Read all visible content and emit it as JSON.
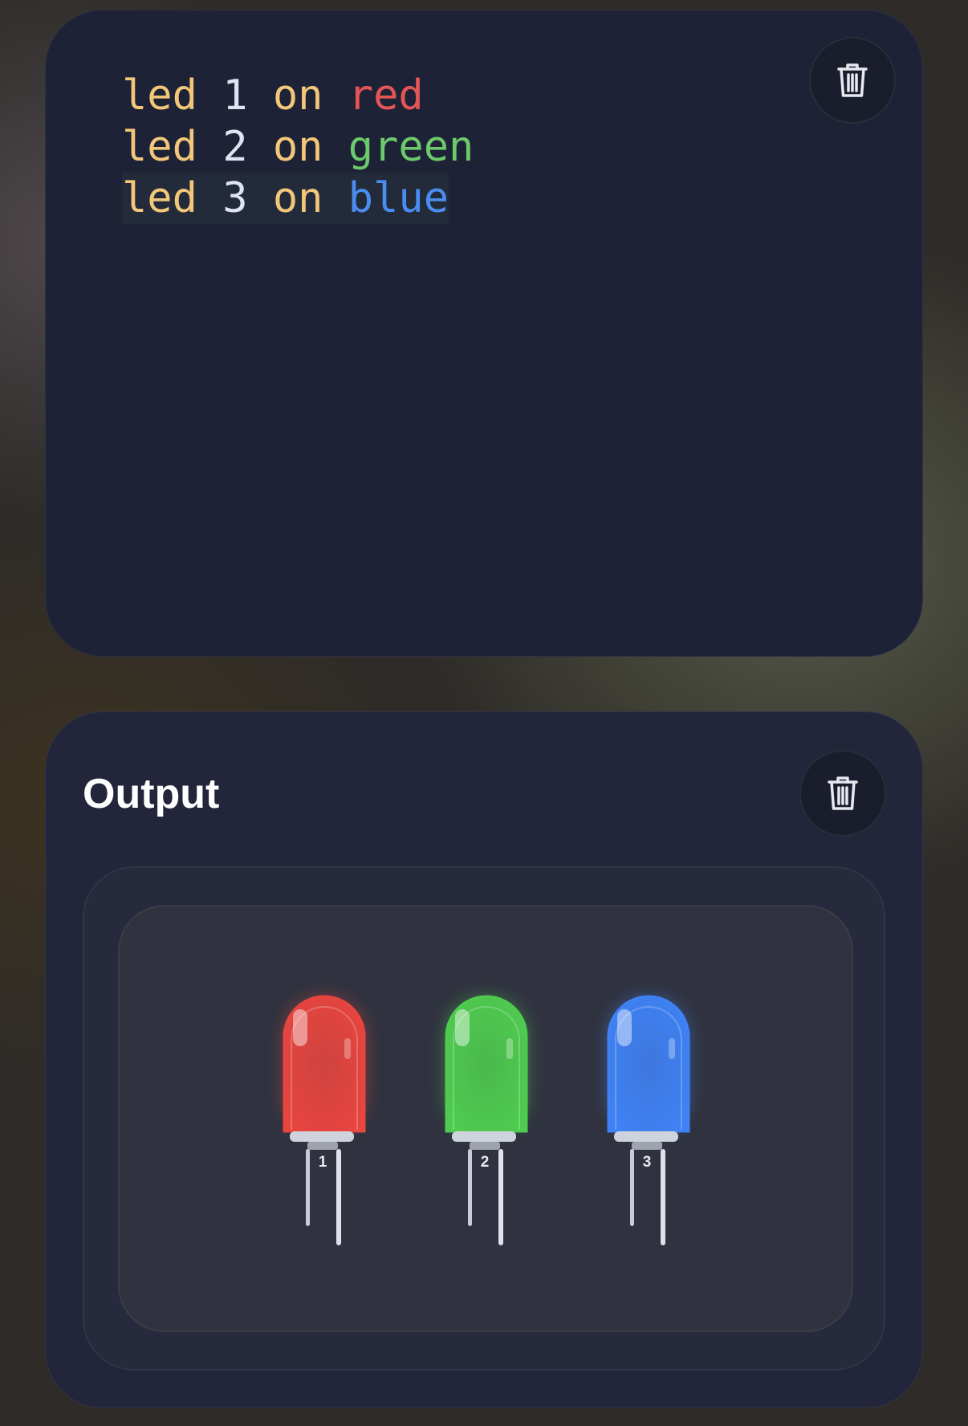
{
  "editor": {
    "lines": [
      {
        "kw1": "led",
        "num": "1",
        "kw2": "on",
        "color": "red"
      },
      {
        "kw1": "led",
        "num": "2",
        "kw2": "on",
        "color": "green"
      },
      {
        "kw1": "led",
        "num": "3",
        "kw2": "on",
        "color": "blue"
      }
    ],
    "trash_icon": "trash-icon"
  },
  "output": {
    "title": "Output",
    "trash_icon": "trash-icon",
    "leds": [
      {
        "label": "1",
        "color": "#e8453f",
        "state": "on"
      },
      {
        "label": "2",
        "color": "#4fcc4f",
        "state": "on"
      },
      {
        "label": "3",
        "color": "#3f82f5",
        "state": "on"
      }
    ]
  }
}
